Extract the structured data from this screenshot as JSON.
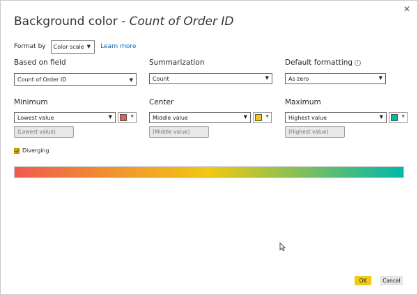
{
  "dialog": {
    "title_prefix": "Background color - ",
    "title_field": "Count of Order ID",
    "close_glyph": "✕"
  },
  "format_by": {
    "label": "Format by",
    "value": "Color scale",
    "learn_more": "Learn more"
  },
  "based_on_field": {
    "label": "Based on field",
    "value": "Count of Order ID"
  },
  "summarization": {
    "label": "Summarization",
    "value": "Count"
  },
  "default_formatting": {
    "label": "Default formatting",
    "value": "As zero"
  },
  "minimum": {
    "label": "Minimum",
    "value": "Lowest value",
    "placeholder": "(Lowest value)",
    "color": "#f05a4f"
  },
  "center": {
    "label": "Center",
    "value": "Middle value",
    "placeholder": "(Middle value)",
    "color": "#f2c811"
  },
  "maximum": {
    "label": "Maximum",
    "value": "Highest value",
    "placeholder": "(Highest value)",
    "color": "#01b8aa"
  },
  "diverging": {
    "label": "Diverging",
    "checked": true
  },
  "buttons": {
    "ok": "OK",
    "cancel": "Cancel"
  }
}
